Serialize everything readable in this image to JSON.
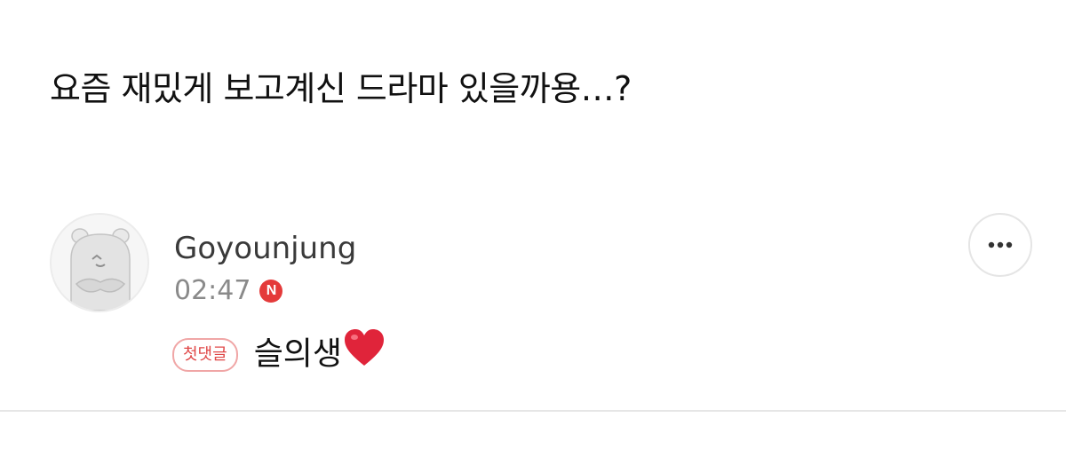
{
  "post": {
    "title": "요즘 재밌게 보고계신 드라마 있을까용…?"
  },
  "comment": {
    "author": "Goyounjung",
    "time": "02:47",
    "new_badge": "N",
    "first_comment_badge": "첫댓글",
    "text": "슬의생",
    "avatar_icon": "hamster-avatar-icon",
    "more_icon": "more-dots-icon"
  },
  "colors": {
    "accent_red": "#e43a3a",
    "badge_border": "#f0a6a6",
    "heart": "#e0243a"
  }
}
